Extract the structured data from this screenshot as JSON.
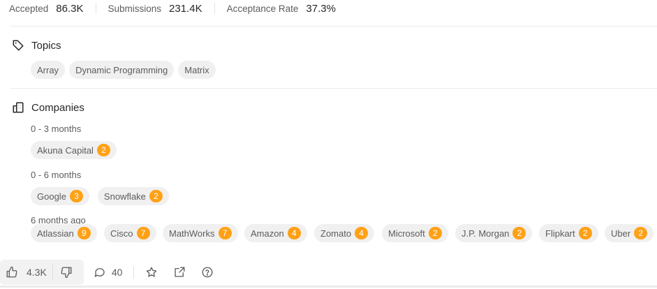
{
  "stats": [
    {
      "label": "Accepted",
      "value": "86.3K"
    },
    {
      "label": "Submissions",
      "value": "231.4K"
    },
    {
      "label": "Acceptance Rate",
      "value": "37.3%"
    }
  ],
  "topics": {
    "title": "Topics",
    "tags": [
      "Array",
      "Dynamic Programming",
      "Matrix"
    ]
  },
  "companies": {
    "title": "Companies",
    "groups": [
      {
        "period": "0 - 3 months",
        "items": [
          {
            "name": "Akuna Capital",
            "count": "2"
          }
        ]
      },
      {
        "period": "0 - 6 months",
        "items": [
          {
            "name": "Google",
            "count": "3"
          },
          {
            "name": "Snowflake",
            "count": "2"
          }
        ]
      },
      {
        "period": "6 months ago",
        "items": [
          {
            "name": "Atlassian",
            "count": "9"
          },
          {
            "name": "Cisco",
            "count": "7"
          },
          {
            "name": "MathWorks",
            "count": "7"
          },
          {
            "name": "Amazon",
            "count": "4"
          },
          {
            "name": "Zomato",
            "count": "4"
          },
          {
            "name": "Microsoft",
            "count": "2"
          },
          {
            "name": "J.P. Morgan",
            "count": "2"
          },
          {
            "name": "Flipkart",
            "count": "2"
          },
          {
            "name": "Uber",
            "count": "2"
          }
        ]
      }
    ]
  },
  "actions": {
    "likes": "4.3K",
    "comments": "40"
  },
  "colors": {
    "badge": "#ffa116",
    "chip": "#f0f0f0"
  },
  "icons": [
    "tag-icon",
    "building-icon",
    "thumbs-up-icon",
    "thumbs-down-icon",
    "comment-icon",
    "star-icon",
    "share-icon",
    "help-icon"
  ]
}
